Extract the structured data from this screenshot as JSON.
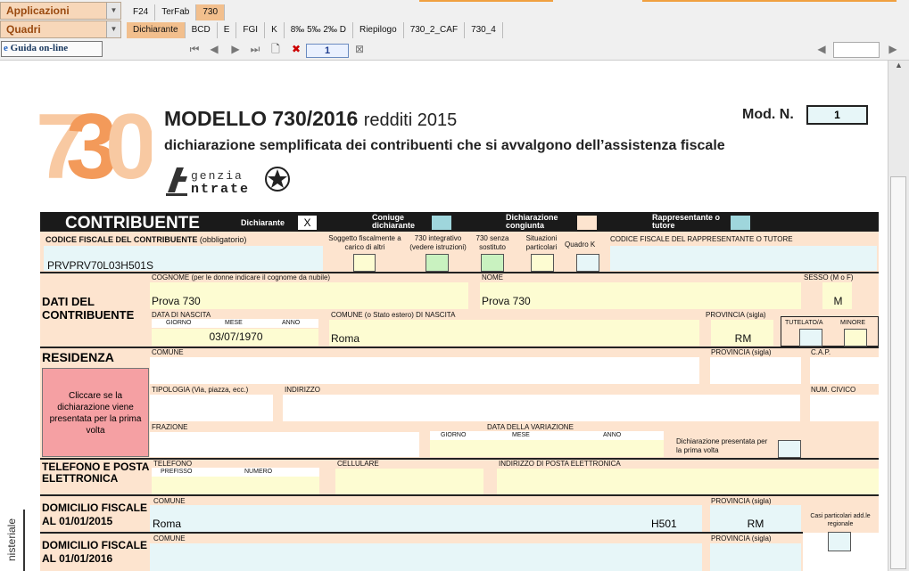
{
  "toolbar": {
    "applicazioni": "Applicazioni",
    "quadri": "Quadri",
    "top_tabs": [
      "F24",
      "TerFab",
      "730"
    ],
    "bottom_tabs": [
      "Dichiarante",
      "BCD",
      "E",
      "FGI",
      "K",
      "8‰ 5‰ 2‰ D",
      "Riepilogo",
      "730_2_CAF",
      "730_4"
    ],
    "help": "Guida on-line",
    "page": "1"
  },
  "header": {
    "title": "MODELLO 730/2016",
    "title_suffix": "redditi 2015",
    "subtitle": "dichiarazione semplificata dei contribuenti che si avvalgono dell’assistenza fiscale",
    "logo_text": "730",
    "agenzia_line1": "genzia",
    "agenzia_line2": "ntrate",
    "mod_label": "Mod. N.",
    "mod_value": "1"
  },
  "bar": {
    "title": "CONTRIBUENTE",
    "dichiarante": "Dichiarante",
    "dichiarante_value": "X",
    "coniuge": "Coniuge dichiarante",
    "congiunta": "Dichiarazione congiunta",
    "rappresentante": "Rappresentante o tutore"
  },
  "row1": {
    "cf_label": "CODICE FISCALE DEL CONTRIBUENTE",
    "cf_obbl": "(obbligatorio)",
    "cf_value": "PRVPRV70L03H501S",
    "soggetto": "Soggetto fiscalmente a carico di altri",
    "integrativo": "730 integrativo (vedere istruzioni)",
    "senza_sostituto": "730 senza sostituto",
    "situazioni": "Situazioni particolari",
    "quadro_k": "Quadro K",
    "cf_rappresentante": "CODICE FISCALE DEL RAPPRESENTANTE O TUTORE"
  },
  "dati": {
    "section": "DATI DEL CONTRIBUENTE",
    "cognome_label": "COGNOME (per le donne indicare il cognome da nubile)",
    "cognome_value": "Prova 730",
    "nome_label": "NOME",
    "nome_value": "Prova 730",
    "sesso_label": "SESSO (M o F)",
    "sesso_value": "M",
    "nascita_label": "DATA DI NASCITA",
    "giorno": "GIORNO",
    "mese": "MESE",
    "anno": "ANNO",
    "nascita_value": "03/07/1970",
    "comune_nascita_label": "COMUNE (o Stato estero) DI NASCITA",
    "comune_nascita_value": "Roma",
    "provincia_label": "PROVINCIA (sigla)",
    "provincia_value": "RM",
    "tutelato": "TUTELATO/A",
    "minore": "MINORE"
  },
  "residenza": {
    "section": "RESIDENZA",
    "comune": "COMUNE",
    "provincia": "PROVINCIA (sigla)",
    "cap": "C.A.P.",
    "tipologia": "TIPOLOGIA (Via, piazza, ecc.)",
    "indirizzo": "INDIRIZZO",
    "civico": "NUM. CIVICO",
    "frazione": "FRAZIONE",
    "data_variazione": "DATA DELLA VARIAZIONE",
    "giorno": "GIORNO",
    "mese": "MESE",
    "anno": "ANNO",
    "prima_volta": "Dichiarazione presentata per la prima volta",
    "pink_button": "Cliccare se la dichiarazione viene presentata per la prima volta"
  },
  "telefono": {
    "section": "TELEFONO E POSTA ELETTRONICA",
    "telefono": "TELEFONO",
    "prefisso": "PREFISSO",
    "numero": "NUMERO",
    "cellulare": "CELLULARE",
    "email": "INDIRIZZO DI POSTA ELETTRONICA"
  },
  "domicilio2015": {
    "section": "DOMICILIO FISCALE AL 01/01/2015",
    "comune": "COMUNE",
    "comune_value": "Roma",
    "codice_value": "H501",
    "provincia": "PROVINCIA (sigla)",
    "provincia_value": "RM",
    "casi": "Casi particolari add.le regionale"
  },
  "domicilio2016": {
    "section": "DOMICILIO FISCALE AL 01/01/2016",
    "comune": "COMUNE",
    "provincia": "PROVINCIA (sigla)"
  },
  "side_text": "nisteriale"
}
